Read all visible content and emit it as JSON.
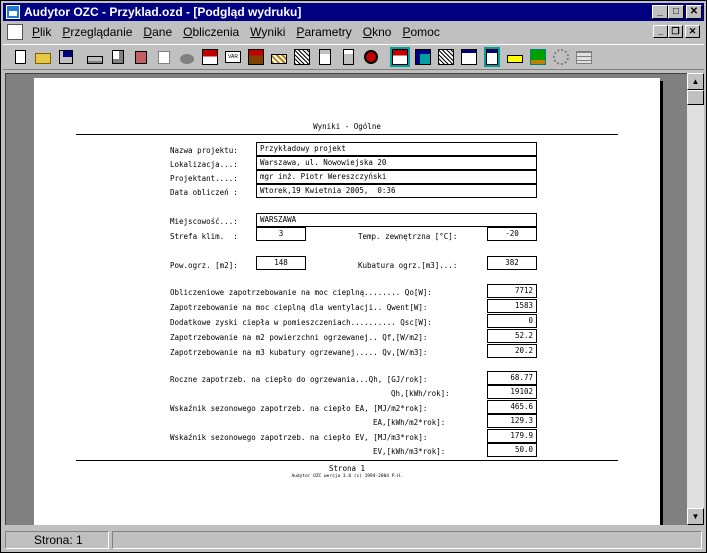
{
  "window": {
    "title": "Audytor OZC - Przyklad.ozd - [Podgląd wydruku]",
    "min_glyph": "_",
    "max_glyph": "□",
    "close_glyph": "✕",
    "mdi_min_glyph": "_",
    "mdi_restore_glyph": "❐",
    "mdi_close_glyph": "✕"
  },
  "menu": [
    {
      "hot": "P",
      "rest": "lik"
    },
    {
      "hot": "P",
      "rest": "rzeglądanie"
    },
    {
      "hot": "D",
      "rest": "ane"
    },
    {
      "hot": "O",
      "rest": "bliczenia"
    },
    {
      "hot": "W",
      "rest": "yniki"
    },
    {
      "hot": "P",
      "rest": "arametry"
    },
    {
      "hot": "O",
      "rest": "kno"
    },
    {
      "hot": "P",
      "rest": "omoc"
    }
  ],
  "toolbar_icons": [
    "new-file-icon",
    "open-folder-icon",
    "save-icon",
    "print-icon",
    "print-preview-icon",
    "stamp-icon",
    "copy-icon",
    "find-icon",
    "house-icon",
    "var-icon",
    "building-icon",
    "wall-hatch-icon",
    "document-icon",
    "calculator-icon",
    "no-entry-icon",
    "house-blue-icon",
    "globe-icon",
    "hatch-icon",
    "window-icon",
    "document-blue-icon",
    "yellow-rect-icon",
    "tree-icon",
    "gear-icon",
    "table-icon"
  ],
  "colors": {
    "title_bar": "#000080",
    "workspace": "#808080",
    "page": "#ffffff"
  },
  "report": {
    "title": "Wyniki - Ogólne",
    "fields": {
      "nazwa_label": "Nazwa projektu:",
      "nazwa_value": "Przykładowy projekt",
      "lokalizacja_label": "Lokalizacja...:",
      "lokalizacja_value": "Warszawa, ul. Nowowiejska 20",
      "projektant_label": "Projektant....:",
      "projektant_value": "mgr inż. Piotr Wereszczyński",
      "data_label": "Data obliczeń :",
      "data_value": "Wtorek,19 Kwietnia 2005,  0:36",
      "miejscowosc_label": "Miejscowość...:",
      "miejscowosc_value": "WARSZAWA",
      "strefa_label": "Strefa klim.  :",
      "strefa_value": "3",
      "temp_label": "Temp. zewnętrzna [°C]:",
      "temp_value": "-20",
      "pow_label": "Pow.ogrz. [m2]:",
      "pow_value": "148",
      "kub_label": "Kubatura ogrz.[m3]...:",
      "kub_value": "382"
    },
    "power_rows": [
      {
        "label": "Obliczeniowe zapotrzebowanie na moc cieplną........ Qo[W]:",
        "value": "7712"
      },
      {
        "label": "Zapotrzebowanie na moc cieplną dla wentylacji.. Qwent[W]:",
        "value": "1583"
      },
      {
        "label": "Dodatkowe zyski ciepła w pomieszczeniach.......... Qsc[W]:",
        "value": "0"
      },
      {
        "label": "Zapotrzebowanie na m2 powierzchni ogrzewanej.. Qf,[W/m2]:",
        "value": "52.2"
      },
      {
        "label": "Zapotrzebowanie na m3 kubatury ogrzewanej..... Qv,[W/m3]:",
        "value": "20.2"
      }
    ],
    "energy_rows": [
      {
        "label": "Roczne zapotrzeb. na ciepło do ogrzewania...Qh, [GJ/rok]:",
        "value": "68.77"
      },
      {
        "label": "Qh,[kWh/rok]:",
        "value": "19102"
      },
      {
        "label": "Wskaźnik sezonowego zapotrzeb. na ciepło EA, [MJ/m2*rok]:",
        "value": "465.6"
      },
      {
        "label": "EA,[kWh/m2*rok]:",
        "value": "129.3"
      },
      {
        "label": "Wskaźnik sezonowego zapotrzeb. na ciepło EV, [MJ/m3*rok]:",
        "value": "179.9"
      },
      {
        "label": "EV,[kWh/m3*rok]:",
        "value": "50.0"
      }
    ],
    "footer_page": "Strona 1",
    "footer_small": "Audytor OZC wersja 3.0 (c) 1994-2004 P.H."
  },
  "status": {
    "page": "Strona: 1",
    "empty": ""
  }
}
